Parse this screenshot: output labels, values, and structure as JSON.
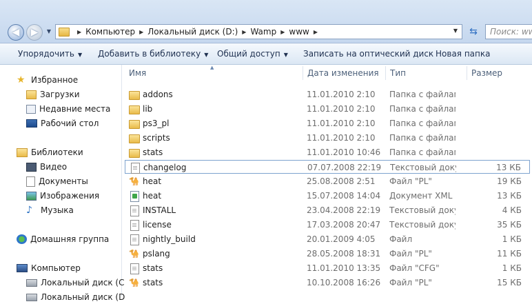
{
  "address": {
    "crumbs": [
      "Компьютер",
      "Локальный диск (D:)",
      "Wamp",
      "www"
    ],
    "search_placeholder": "Поиск: www"
  },
  "toolbar": {
    "organize": "Упорядочить",
    "add_library": "Добавить в библиотеку",
    "share": "Общий доступ",
    "burn": "Записать на оптический диск",
    "new_folder": "Новая папка"
  },
  "sidebar": {
    "favorites": "Избранное",
    "downloads": "Загрузки",
    "recent": "Недавние места",
    "desktop": "Рабочий стол",
    "libraries": "Библиотеки",
    "video": "Видео",
    "documents": "Документы",
    "images": "Изображения",
    "music": "Музыка",
    "homegroup": "Домашняя группа",
    "computer": "Компьютер",
    "local_c": "Локальный диск (C",
    "local_d": "Локальный диск (D"
  },
  "columns": {
    "name": "Имя",
    "date": "Дата изменения",
    "type": "Тип",
    "size": "Размер"
  },
  "files": [
    {
      "name": "addons",
      "date": "11.01.2010 2:10",
      "type": "Папка с файлами",
      "size": "",
      "icon": "folder-icon"
    },
    {
      "name": "lib",
      "date": "11.01.2010 2:10",
      "type": "Папка с файлами",
      "size": "",
      "icon": "folder-icon"
    },
    {
      "name": "ps3_pl",
      "date": "11.01.2010 2:10",
      "type": "Папка с файлами",
      "size": "",
      "icon": "folder-icon"
    },
    {
      "name": "scripts",
      "date": "11.01.2010 2:10",
      "type": "Папка с файлами",
      "size": "",
      "icon": "folder-icon"
    },
    {
      "name": "stats",
      "date": "11.01.2010 10:46",
      "type": "Папка с файлами",
      "size": "",
      "icon": "folder-icon"
    },
    {
      "name": "changelog",
      "date": "07.07.2008 22:19",
      "type": "Текстовый докум...",
      "size": "13 КБ",
      "icon": "text-file-icon",
      "selected": true
    },
    {
      "name": "heat",
      "date": "25.08.2008 2:51",
      "type": "Файл \"PL\"",
      "size": "19 КБ",
      "icon": "perl-file-icon"
    },
    {
      "name": "heat",
      "date": "15.07.2008 14:04",
      "type": "Документ XML",
      "size": "13 КБ",
      "icon": "xml-file-icon"
    },
    {
      "name": "INSTALL",
      "date": "23.04.2008 22:19",
      "type": "Текстовый докум...",
      "size": "4 КБ",
      "icon": "text-file-icon"
    },
    {
      "name": "license",
      "date": "17.03.2008 20:47",
      "type": "Текстовый докум...",
      "size": "35 КБ",
      "icon": "text-file-icon"
    },
    {
      "name": "nightly_build",
      "date": "20.01.2009 4:05",
      "type": "Файл",
      "size": "1 КБ",
      "icon": "text-file-icon"
    },
    {
      "name": "pslang",
      "date": "28.05.2008 18:31",
      "type": "Файл \"PL\"",
      "size": "11 КБ",
      "icon": "perl-file-icon"
    },
    {
      "name": "stats",
      "date": "11.01.2010 13:35",
      "type": "Файл \"CFG\"",
      "size": "1 КБ",
      "icon": "text-file-icon"
    },
    {
      "name": "stats",
      "date": "10.10.2008 16:26",
      "type": "Файл \"PL\"",
      "size": "15 КБ",
      "icon": "perl-file-icon"
    }
  ]
}
